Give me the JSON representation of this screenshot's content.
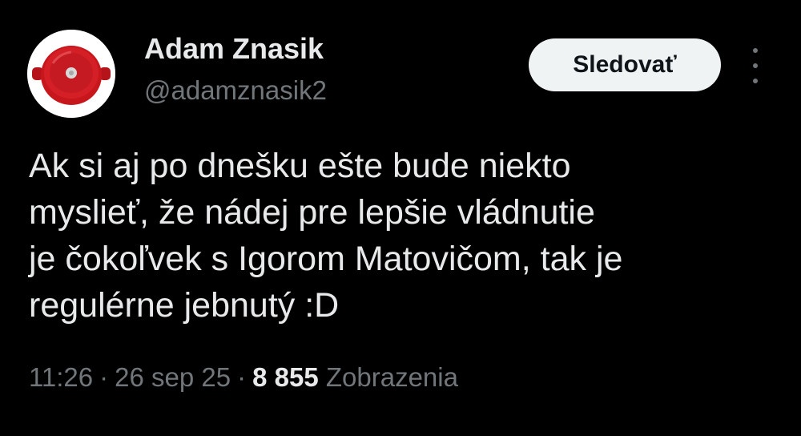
{
  "author": {
    "display_name": "Adam Znasik",
    "handle": "@adamznasik2",
    "avatar_icon": "red-cooking-pot-icon"
  },
  "actions": {
    "follow_label": "Sledovať",
    "more_icon": "more-vertical-icon"
  },
  "tweet": {
    "lines": [
      "Ak si aj po dnešku ešte bude niekto",
      "myslieť, že nádej pre lepšie vládnutie",
      "je čokoľvek s Igorom Matovičom, tak je",
      "regulérne jebnutý :D"
    ]
  },
  "meta": {
    "time": "11:26",
    "separator": "·",
    "date": "26 sep 25",
    "views_count": "8 855",
    "views_label": "Zobrazenia"
  },
  "colors": {
    "background": "#000000",
    "primary_text": "#e7e9ea",
    "secondary_text": "#71767b",
    "button_bg": "#eff3f4",
    "avatar_accent": "#c8161d"
  }
}
